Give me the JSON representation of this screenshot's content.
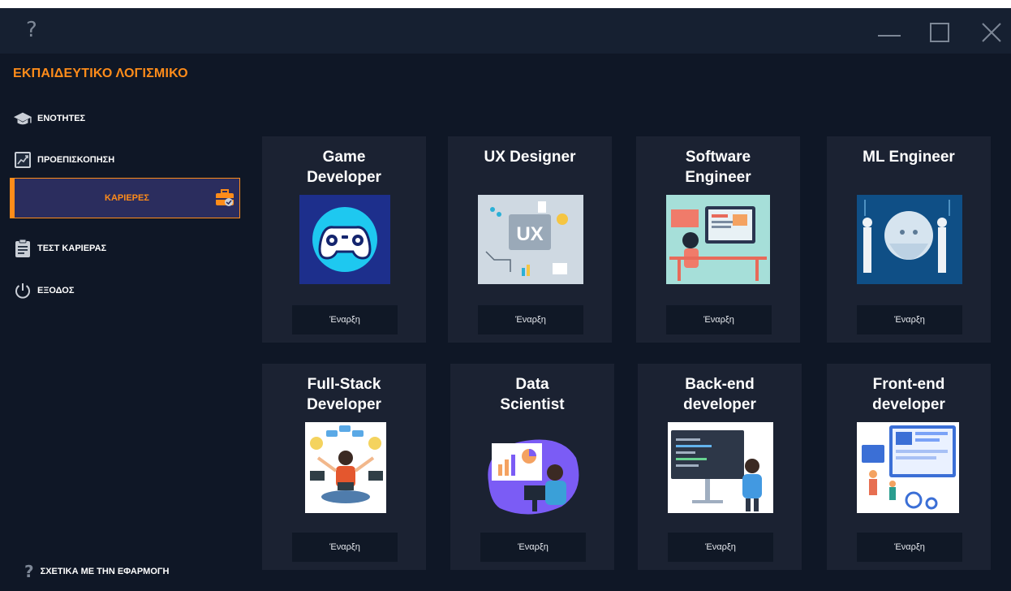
{
  "window": {
    "help_glyph": "?"
  },
  "sidebar": {
    "app_title": "ΕΚΠΑΙΔΕΥΤΙΚΟ ΛΟΓΙΣΜΙΚΟ",
    "items": [
      {
        "label": "ΕΝΟΤΗΤΕΣ",
        "icon": "graduation-cap-icon"
      },
      {
        "label": "ΠΡΟΕΠΙΣΚΟΠΗΣΗ",
        "icon": "chart-line-icon"
      },
      {
        "label": "ΚΑΡΙΕΡΕΣ",
        "icon": "briefcase-icon",
        "selected": true
      },
      {
        "label": "ΤΕΣΤ ΚΑΡΙΕΡΑΣ",
        "icon": "clipboard-icon"
      },
      {
        "label": "ΕΞΟΔΟΣ",
        "icon": "power-icon"
      }
    ],
    "about_glyph": "?",
    "about_label": "ΣΧΕΤΙΚΑ ΜΕ ΤΗΝ ΕΦΑΡΜΟΓΗ"
  },
  "careers": [
    {
      "title_lines": [
        "Game",
        "Developer"
      ],
      "button": "Έναρξη"
    },
    {
      "title_lines": [
        "UX Designer"
      ],
      "button": "Έναρξη"
    },
    {
      "title_lines": [
        "Software",
        "Engineer"
      ],
      "button": "Έναρξη"
    },
    {
      "title_lines": [
        "ML Engineer"
      ],
      "button": "Έναρξη"
    },
    {
      "title_lines": [
        "Full-Stack",
        "Developer"
      ],
      "button": "Έναρξη"
    },
    {
      "title_lines": [
        "Data",
        "Scientist"
      ],
      "button": "Έναρξη"
    },
    {
      "title_lines": [
        "Back-end",
        "developer"
      ],
      "button": "Έναρξη"
    },
    {
      "title_lines": [
        "Front-end",
        "developer"
      ],
      "button": "Έναρξη"
    }
  ],
  "image_text": {
    "ux": "UX"
  },
  "colors": {
    "accent": "#ff8c1a",
    "background": "#0f1726",
    "card": "#1b2232",
    "selected_nav": "#2b2d5e"
  }
}
